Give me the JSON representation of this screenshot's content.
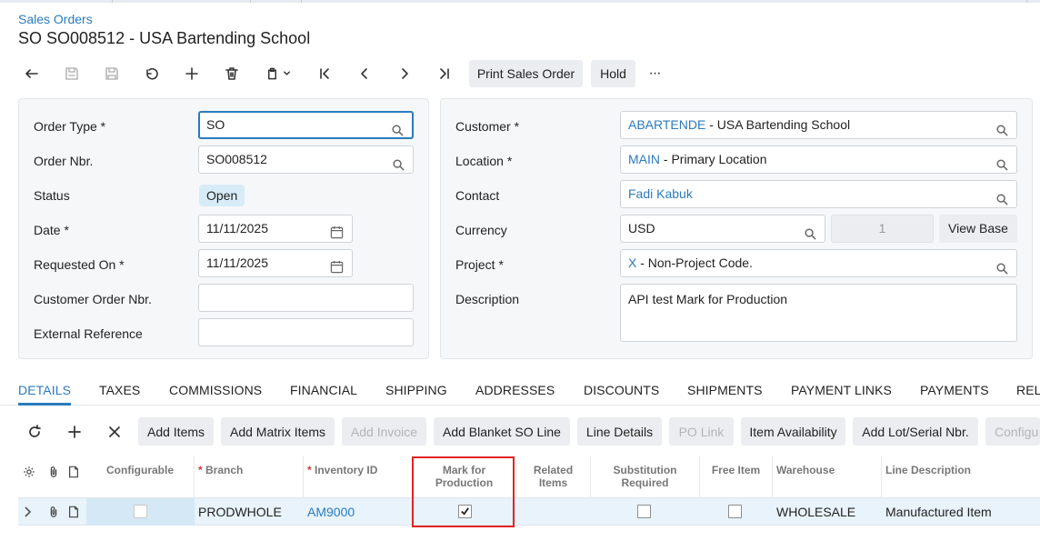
{
  "breadcrumb": "Sales Orders",
  "page_title": "SO SO008512 - USA Bartending School",
  "toolbar": {
    "print_label": "Print Sales Order",
    "hold_label": "Hold",
    "more_label": "···"
  },
  "left_form": {
    "order_type_label": "Order Type",
    "order_type_value": "SO",
    "order_nbr_label": "Order Nbr.",
    "order_nbr_value": "SO008512",
    "status_label": "Status",
    "status_value": "Open",
    "date_label": "Date",
    "date_value": "11/11/2025",
    "requested_on_label": "Requested On",
    "requested_on_value": "11/11/2025",
    "customer_order_nbr_label": "Customer Order Nbr.",
    "customer_order_nbr_value": "",
    "external_reference_label": "External Reference",
    "external_reference_value": ""
  },
  "right_form": {
    "customer_label": "Customer",
    "customer_code": "ABARTENDE",
    "customer_name": " - USA Bartending School",
    "location_label": "Location",
    "location_code": "MAIN",
    "location_name": " - Primary Location",
    "contact_label": "Contact",
    "contact_value": "Fadi Kabuk",
    "currency_label": "Currency",
    "currency_value": "USD",
    "currency_rate": "1",
    "view_base_label": "View Base",
    "project_label": "Project",
    "project_code": "X",
    "project_name": " - Non-Project Code.",
    "description_label": "Description",
    "description_value": "API test Mark for Production"
  },
  "tabs": [
    "DETAILS",
    "TAXES",
    "COMMISSIONS",
    "FINANCIAL",
    "SHIPPING",
    "ADDRESSES",
    "DISCOUNTS",
    "SHIPMENTS",
    "PAYMENT LINKS",
    "PAYMENTS",
    "REL"
  ],
  "active_tab": "DETAILS",
  "grid_toolbar": {
    "add_items": "Add Items",
    "add_matrix_items": "Add Matrix Items",
    "add_invoice": "Add Invoice",
    "add_blanket": "Add Blanket SO Line",
    "line_details": "Line Details",
    "po_link": "PO Link",
    "item_availability": "Item Availability",
    "add_lot_serial": "Add Lot/Serial Nbr.",
    "configure": "Configu"
  },
  "grid": {
    "columns": {
      "configurable": "Configurable",
      "branch": "Branch",
      "inventory_id": "Inventory ID",
      "mark_for_production": "Mark for Production",
      "related_items": "Related Items",
      "substitution_required": "Substitution Required",
      "free_item": "Free Item",
      "warehouse": "Warehouse",
      "line_description": "Line Description"
    },
    "rows": [
      {
        "configurable": false,
        "branch": "PRODWHOLE",
        "inventory_id": "AM9000",
        "mark_for_production": true,
        "related_items": "",
        "substitution_required": false,
        "free_item": false,
        "warehouse": "WHOLESALE",
        "line_description": "Manufactured Item"
      }
    ]
  },
  "colors": {
    "accent": "#2b7bbd",
    "highlight": "#e02424",
    "selected_row": "#e8f3fb"
  }
}
